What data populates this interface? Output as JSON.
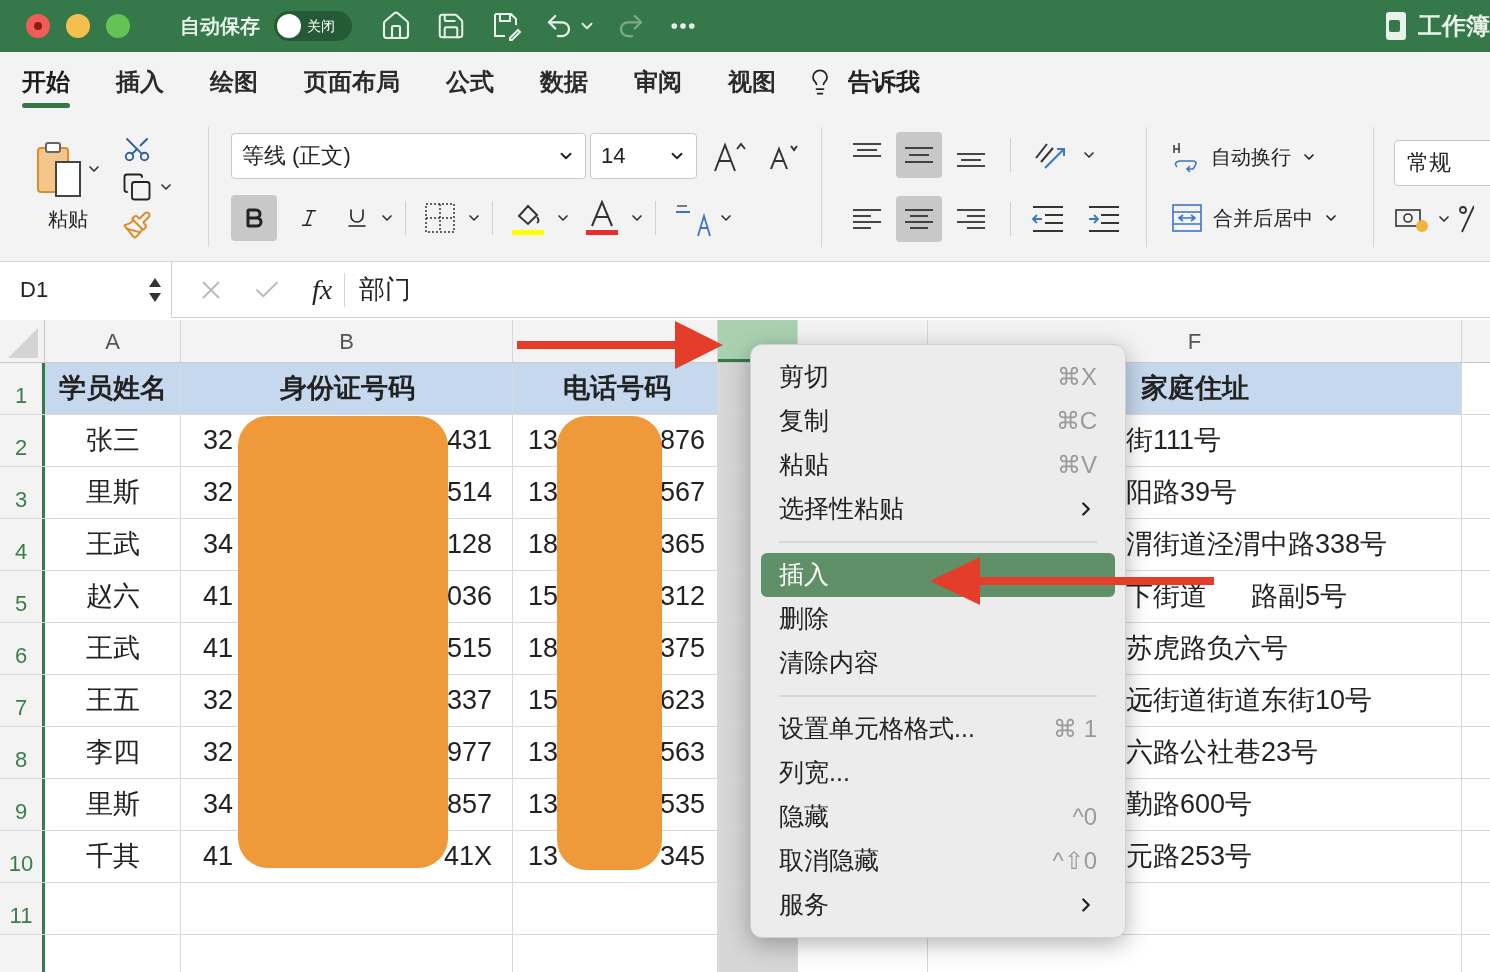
{
  "title_bar": {
    "autosave_label": "自动保存",
    "autosave": {
      "label": "关闭",
      "on": false
    },
    "redo_disabled": true,
    "document_title": "工作簿"
  },
  "tabs": [
    {
      "label": "开始",
      "selected": true
    },
    {
      "label": "插入",
      "selected": false
    },
    {
      "label": "绘图",
      "selected": false
    },
    {
      "label": "页面布局",
      "selected": false
    },
    {
      "label": "公式",
      "selected": false
    },
    {
      "label": "数据",
      "selected": false
    },
    {
      "label": "审阅",
      "selected": false
    },
    {
      "label": "视图",
      "selected": false
    }
  ],
  "tell_me": "告诉我",
  "ribbon": {
    "paste_label": "粘贴",
    "font_name": "等线 (正文)",
    "font_size": "14",
    "bold": true,
    "italic": false,
    "underline": false,
    "vertical_align": [
      {
        "kind": "top",
        "selected": false
      },
      {
        "kind": "middle",
        "selected": true
      },
      {
        "kind": "bottom",
        "selected": false
      }
    ],
    "horizontal_align": [
      {
        "kind": "left",
        "selected": false
      },
      {
        "kind": "center",
        "selected": true
      },
      {
        "kind": "right",
        "selected": false
      }
    ],
    "wrap_text": "自动换行",
    "merge": "合并后居中",
    "number_format": "常规"
  },
  "formula_bar": {
    "name_box": "D1",
    "function_label": "fx",
    "formula": "部门"
  },
  "sheet": {
    "columns": [
      {
        "letter": "A",
        "selected": false
      },
      {
        "letter": "B",
        "selected": false
      },
      {
        "selected": false
      },
      {
        "selected": true
      },
      {
        "selected": false
      },
      {
        "letter": "F",
        "selected": false
      }
    ],
    "rows": [
      {
        "number": "1",
        "kind": "header",
        "cells": [
          [
            "学员姓名"
          ],
          [
            "身份证号码"
          ],
          [
            "电话号码"
          ],
          [],
          [],
          [
            "家庭住址"
          ]
        ]
      },
      {
        "number": "2",
        "kind": "data",
        "cells": [
          [
            "张三"
          ],
          [
            "32",
            "431"
          ],
          [
            "13",
            "876"
          ],
          [],
          [],
          [
            "街111号"
          ]
        ]
      },
      {
        "number": "3",
        "kind": "data",
        "cells": [
          [
            "里斯"
          ],
          [
            "32",
            "514"
          ],
          [
            "13",
            "567"
          ],
          [],
          [],
          [
            "阳路39号"
          ]
        ]
      },
      {
        "number": "4",
        "kind": "data",
        "cells": [
          [
            "王武"
          ],
          [
            "34",
            "128"
          ],
          [
            "18",
            "365"
          ],
          [],
          [],
          [
            "渭街道泾渭中路338号"
          ]
        ]
      },
      {
        "number": "5",
        "kind": "data",
        "cells": [
          [
            "赵六"
          ],
          [
            "41",
            "036"
          ],
          [
            "15",
            "312"
          ],
          [],
          [],
          [
            "下街道",
            "路副5号"
          ]
        ]
      },
      {
        "number": "6",
        "kind": "data",
        "cells": [
          [
            "王武"
          ],
          [
            "41",
            "515"
          ],
          [
            "18",
            "375"
          ],
          [],
          [],
          [
            "苏虎路负六号"
          ]
        ]
      },
      {
        "number": "7",
        "kind": "data",
        "cells": [
          [
            "王五"
          ],
          [
            "32",
            "337"
          ],
          [
            "15",
            "623"
          ],
          [],
          [],
          [
            "远街道街道东街10号"
          ]
        ]
      },
      {
        "number": "8",
        "kind": "data",
        "cells": [
          [
            "李四"
          ],
          [
            "32",
            "977"
          ],
          [
            "13",
            "563"
          ],
          [],
          [],
          [
            "六路公社巷23号"
          ]
        ]
      },
      {
        "number": "9",
        "kind": "data",
        "cells": [
          [
            "里斯"
          ],
          [
            "34",
            "857"
          ],
          [
            "13",
            "535"
          ],
          [],
          [],
          [
            "勤路600号"
          ]
        ]
      },
      {
        "number": "10",
        "kind": "data",
        "cells": [
          [
            "千其"
          ],
          [
            "41",
            "41X"
          ],
          [
            "13",
            "345"
          ],
          [],
          [],
          [
            "元路253号"
          ]
        ]
      },
      {
        "number": "11",
        "kind": "data",
        "cells": [
          [],
          [],
          [],
          [],
          [],
          []
        ]
      }
    ]
  },
  "context_menu": [
    {
      "kind": "item",
      "label": "剪切",
      "shortcut": "⌘X",
      "selected": false
    },
    {
      "kind": "item",
      "label": "复制",
      "shortcut": "⌘C",
      "selected": false
    },
    {
      "kind": "item",
      "label": "粘贴",
      "shortcut": "⌘V",
      "selected": false
    },
    {
      "kind": "submenu",
      "label": "选择性粘贴",
      "selected": false
    },
    {
      "kind": "separator"
    },
    {
      "kind": "item",
      "label": "插入",
      "selected": true
    },
    {
      "kind": "item",
      "label": "删除",
      "selected": false
    },
    {
      "kind": "item",
      "label": "清除内容",
      "selected": false
    },
    {
      "kind": "separator"
    },
    {
      "kind": "item",
      "label": "设置单元格格式...",
      "shortcut": "⌘ 1",
      "selected": false
    },
    {
      "kind": "item",
      "label": "列宽...",
      "selected": false
    },
    {
      "kind": "item",
      "label": "隐藏",
      "shortcut": "^0",
      "selected": false
    },
    {
      "kind": "item",
      "label": "取消隐藏",
      "shortcut": "^⇧0",
      "selected": false
    },
    {
      "kind": "submenu",
      "label": "服务",
      "selected": false
    }
  ]
}
